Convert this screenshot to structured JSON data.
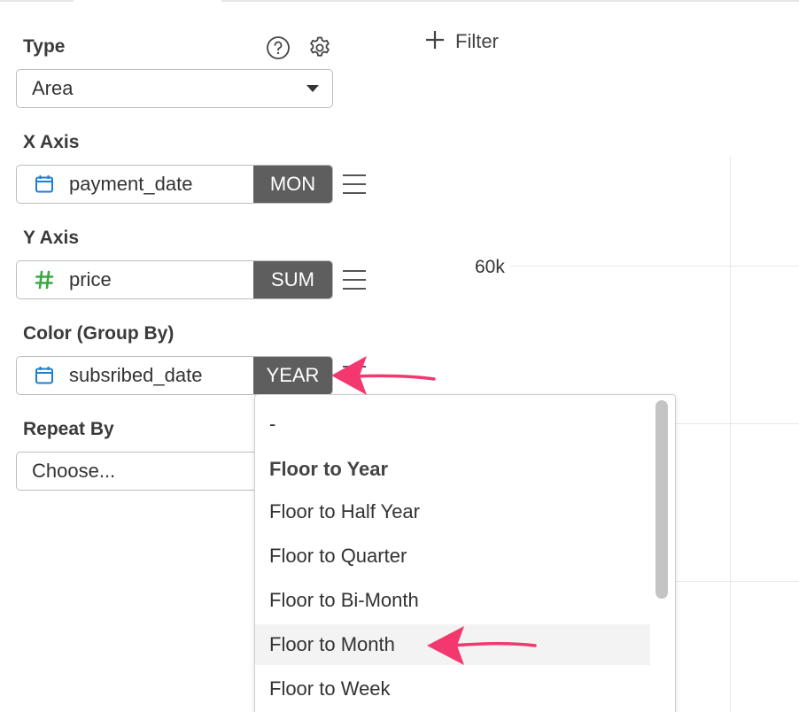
{
  "type_section": {
    "label": "Type",
    "selected": "Area"
  },
  "x_axis": {
    "label": "X Axis",
    "field": "payment_date",
    "field_icon": "calendar-icon",
    "aggregation": "MON"
  },
  "y_axis": {
    "label": "Y Axis",
    "field": "price",
    "field_icon": "hash-icon",
    "aggregation": "SUM"
  },
  "color": {
    "label": "Color (Group By)",
    "field": "subsribed_date",
    "field_icon": "calendar-icon",
    "aggregation": "YEAR"
  },
  "repeat_by": {
    "label": "Repeat By",
    "placeholder": "Choose..."
  },
  "toolbar": {
    "filter_label": "Filter"
  },
  "chart": {
    "y_tick": "60k"
  },
  "dropdown": {
    "items": [
      {
        "label": "-",
        "selected": false
      },
      {
        "label": "Floor to Year",
        "selected": true
      },
      {
        "label": "Floor to Half Year",
        "selected": false
      },
      {
        "label": "Floor to Quarter",
        "selected": false
      },
      {
        "label": "Floor to Bi-Month",
        "selected": false
      },
      {
        "label": "Floor to Month",
        "selected": false,
        "hovered": true
      },
      {
        "label": "Floor to Week",
        "selected": false
      }
    ]
  },
  "colors": {
    "calendar_icon": "#1a7fd4",
    "hash_icon": "#3aa843",
    "agg_bg": "#5e5e5e",
    "annotation_arrow": "#f2386e"
  }
}
